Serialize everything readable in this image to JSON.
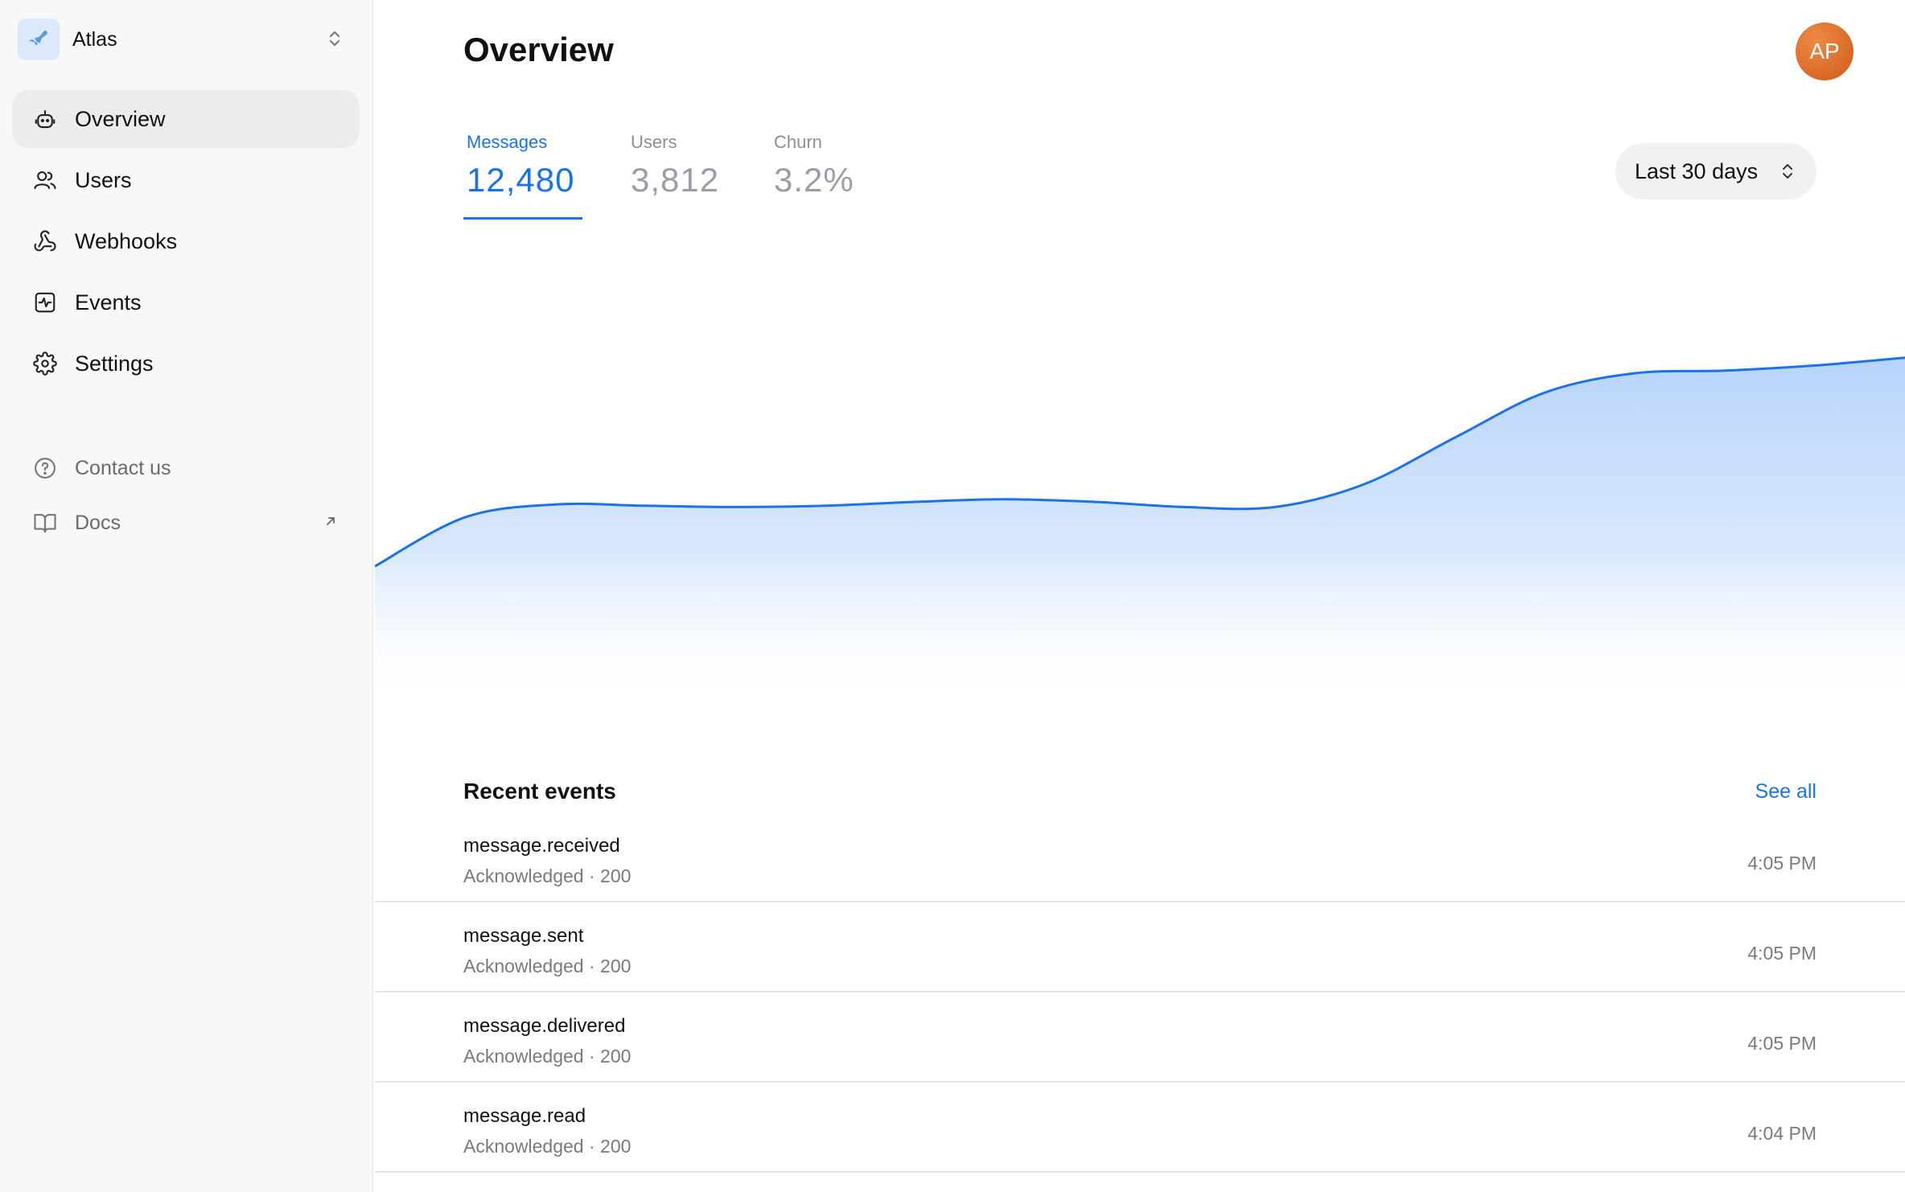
{
  "workspace": {
    "name": "Atlas",
    "logo_icon": "airplane-icon"
  },
  "nav": {
    "items": [
      {
        "label": "Overview",
        "icon": "robot-icon",
        "active": true
      },
      {
        "label": "Users",
        "icon": "users-icon",
        "active": false
      },
      {
        "label": "Webhooks",
        "icon": "webhook-icon",
        "active": false
      },
      {
        "label": "Events",
        "icon": "activity-icon",
        "active": false
      },
      {
        "label": "Settings",
        "icon": "gear-icon",
        "active": false
      }
    ],
    "secondary": [
      {
        "label": "Contact us",
        "icon": "help-circle-icon"
      },
      {
        "label": "Docs",
        "icon": "book-icon",
        "external": true
      }
    ]
  },
  "header": {
    "title": "Overview",
    "avatar_initials": "AP"
  },
  "metrics": [
    {
      "label": "Messages",
      "value": "12,480",
      "active": true
    },
    {
      "label": "Users",
      "value": "3,812",
      "active": false
    },
    {
      "label": "Churn",
      "value": "3.2%",
      "active": false
    }
  ],
  "range": {
    "selected": "Last 30 days"
  },
  "chart_data": {
    "type": "area",
    "series": [
      {
        "values": [
          60,
          98,
          108,
          107,
          106,
          107,
          110,
          112,
          110,
          106,
          106,
          124,
          160,
          195,
          210,
          212,
          216,
          222
        ]
      }
    ]
  },
  "recent": {
    "title": "Recent events",
    "see_all": "See all",
    "events": [
      {
        "name": "message.received",
        "status": "Acknowledged · 200",
        "time": "4:05 PM"
      },
      {
        "name": "message.sent",
        "status": "Acknowledged · 200",
        "time": "4:05 PM"
      },
      {
        "name": "message.delivered",
        "status": "Acknowledged · 200",
        "time": "4:05 PM"
      },
      {
        "name": "message.read",
        "status": "Acknowledged · 200",
        "time": "4:04 PM"
      }
    ]
  },
  "colors": {
    "accent": "#1a73e8",
    "avatar": "#d9661f",
    "chart_fill": "#bcd6fb"
  }
}
